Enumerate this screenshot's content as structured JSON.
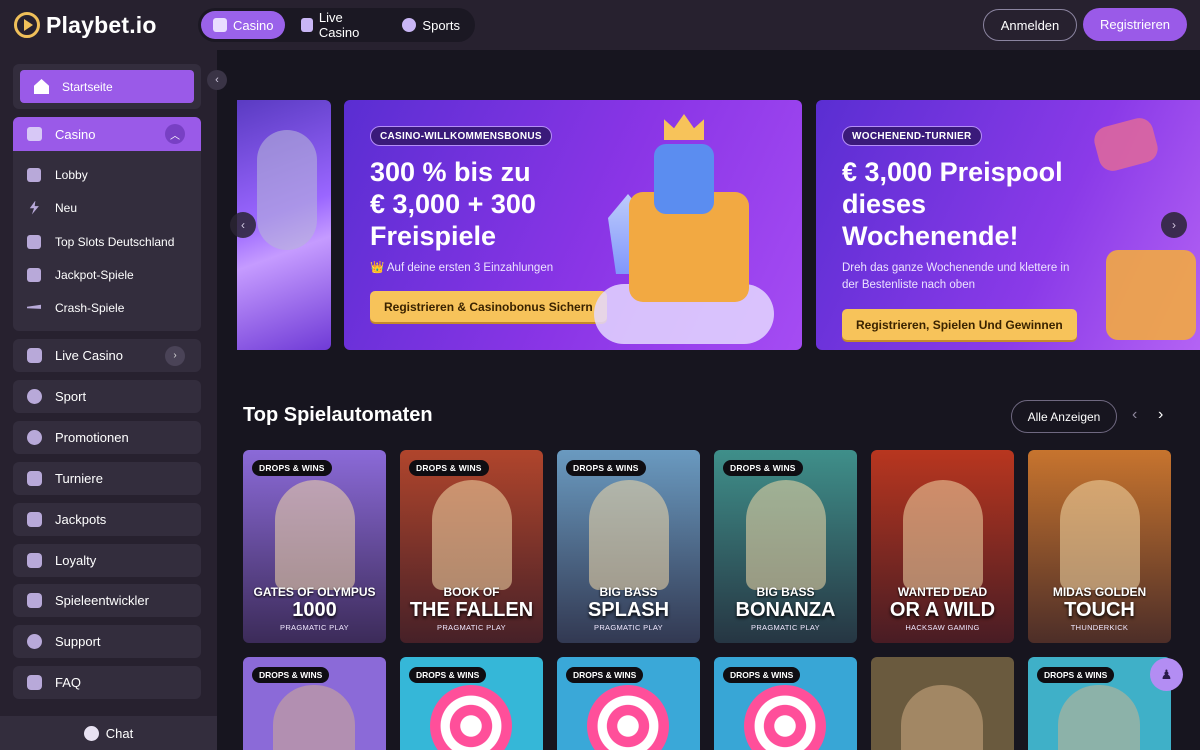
{
  "header": {
    "logo_text": "Playbet.io",
    "tabs": [
      {
        "label": "Casino",
        "active": true,
        "icon": "casino-icon"
      },
      {
        "label": "Live Casino",
        "active": false,
        "icon": "dealer-icon"
      },
      {
        "label": "Sports",
        "active": false,
        "icon": "ball-icon"
      }
    ],
    "login_label": "Anmelden",
    "register_label": "Registrieren"
  },
  "sidebar": {
    "home_label": "Startseite",
    "casino_label": "Casino",
    "casino_sub": [
      {
        "label": "Lobby",
        "icon": "lobby-icon"
      },
      {
        "label": "Neu",
        "icon": "lightning-icon"
      },
      {
        "label": "Top Slots Deutschland",
        "icon": "slots-icon"
      },
      {
        "label": "Jackpot-Spiele",
        "icon": "jackpot-icon"
      },
      {
        "label": "Crash-Spiele",
        "icon": "plane-icon"
      }
    ],
    "items": [
      {
        "label": "Live Casino",
        "icon": "dealer-icon"
      },
      {
        "label": "Sport",
        "icon": "ball-icon"
      },
      {
        "label": "Promotionen",
        "icon": "percent-icon"
      },
      {
        "label": "Turniere",
        "icon": "trophy-icon"
      },
      {
        "label": "Jackpots",
        "icon": "jackpot-icon"
      },
      {
        "label": "Loyalty",
        "icon": "grid-icon"
      },
      {
        "label": "Spieleentwickler",
        "icon": "developer-icon"
      },
      {
        "label": "Support",
        "icon": "support-icon"
      },
      {
        "label": "FAQ",
        "icon": "faq-icon"
      }
    ],
    "chat_label": "Chat"
  },
  "banners": [
    {
      "tag": "CASINO-WILLKOMMENSBONUS",
      "title_lines": [
        "300 % bis zu",
        "€ 3,000 + 300",
        "Freispiele"
      ],
      "subtitle": "👑 Auf deine ersten 3 Einzahlungen",
      "cta": "Registrieren & Casinobonus Sichern"
    },
    {
      "tag": "WOCHENEND-TURNIER",
      "title_lines": [
        "€ 3,000 Preispool",
        "dieses",
        "Wochenende!"
      ],
      "subtitle_lines": [
        "Dreh das ganze Wochenende und klettere in",
        "der Bestenliste nach oben"
      ],
      "cta": "Registrieren, Spielen Und Gewinnen"
    }
  ],
  "section": {
    "title": "Top Spielautomaten",
    "view_all": "Alle Anzeigen",
    "prev": "‹",
    "next": "›"
  },
  "games": [
    {
      "badge": "DROPS & WINS",
      "line1": "GATES OF OLYMPUS",
      "line2": "1000",
      "provider": "PRAGMATIC PLAY",
      "color": "#8b6ad8"
    },
    {
      "badge": "DROPS & WINS",
      "line1": "BOOK OF",
      "line2": "THE FALLEN",
      "provider": "PRAGMATIC PLAY",
      "color": "#b0452c"
    },
    {
      "badge": "DROPS & WINS",
      "line1": "BIG BASS",
      "line2": "SPLASH",
      "provider": "PRAGMATIC PLAY",
      "color": "#6a9ac0"
    },
    {
      "badge": "DROPS & WINS",
      "line1": "BIG BASS",
      "line2": "BONANZA",
      "provider": "PRAGMATIC PLAY",
      "color": "#3f8f8a"
    },
    {
      "badge": "",
      "line1": "WANTED DEAD",
      "line2": "OR A WILD",
      "provider": "HACKSAW GAMING",
      "color": "#b8361f"
    },
    {
      "badge": "",
      "line1": "MIDAS GOLDEN",
      "line2": "TOUCH",
      "provider": "THUNDERKICK",
      "color": "#c7742e"
    }
  ],
  "games_row2": [
    {
      "badge": "DROPS & WINS",
      "color": "#8b6ad8"
    },
    {
      "badge": "DROPS & WINS",
      "color": "#35b7d8"
    },
    {
      "badge": "DROPS & WINS",
      "color": "#3aa8d8"
    },
    {
      "badge": "DROPS & WINS",
      "color": "#38a6d6"
    },
    {
      "badge": "",
      "color": "#6a5a3e"
    },
    {
      "badge": "DROPS & WINS",
      "color": "#3fb0c8"
    }
  ]
}
